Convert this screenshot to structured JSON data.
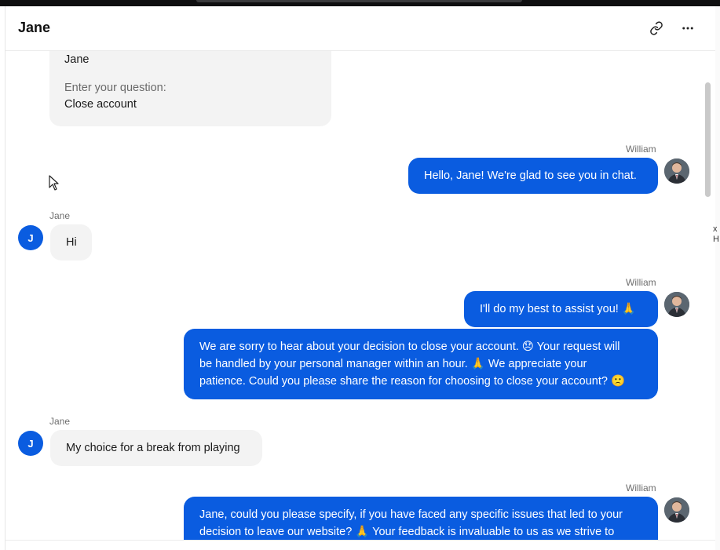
{
  "header": {
    "title": "Jane",
    "link_icon": "link-icon",
    "more_icon": "more-horizontal-icon"
  },
  "colors": {
    "accent": "#0a5ce0",
    "incoming_bubble": "#f3f3f3"
  },
  "form_card": {
    "partial_value": "Jane",
    "question_label": "Enter your question:",
    "question_value": "Close account"
  },
  "messages": [
    {
      "sender": "William",
      "text": "Hello, Jane! We're glad to see you in chat."
    },
    {
      "sender": "Jane",
      "avatar_letter": "J",
      "text": "Hi"
    },
    {
      "sender": "William",
      "text": "I'll do my best to assist you! 🙏"
    },
    {
      "text_lines": [
        "We are sorry to hear about your decision to close your account. 😞 Your request will",
        "be handled by your personal manager within an hour. 🙏 We appreciate your",
        "patience. Could you please share the reason for choosing to close your account? 🙁"
      ]
    },
    {
      "sender": "Jane",
      "avatar_letter": "J",
      "text": "My choice for a break from playing"
    },
    {
      "sender": "William",
      "text_lines": [
        "Jane, could you please specify, if you have faced any specific issues that led to your",
        "decision to leave our website? 🙏 Your feedback is invaluable to us as we strive to"
      ]
    }
  ],
  "edge_fragments": [
    "x",
    "H"
  ]
}
